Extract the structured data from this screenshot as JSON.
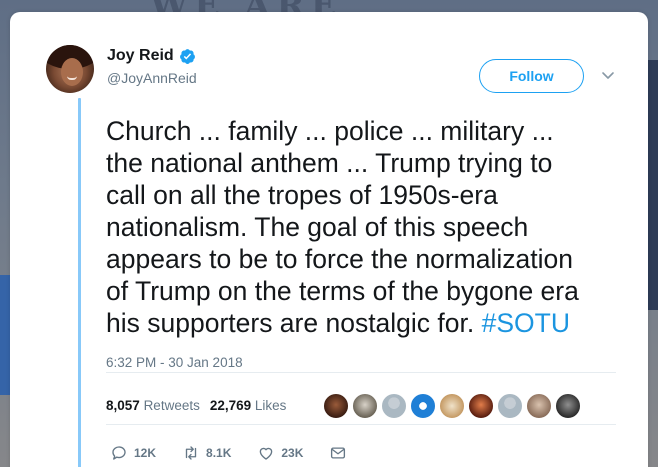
{
  "tweet": {
    "author": {
      "display_name": "Joy Reid",
      "handle": "@JoyAnnReid",
      "verified": true
    },
    "follow_label": "Follow",
    "text_lines": [
      "Church ... family ... police ... military ...",
      "the national anthem ... Trump trying to",
      "call on all the tropes of 1950s-era",
      "nationalism. The goal of this speech",
      "appears to be to force the normalization",
      "of Trump on the terms of the bygone era",
      "his supporters are nostalgic for."
    ],
    "hashtag": "#SOTU",
    "timestamp": "6:32 PM - 30 Jan 2018",
    "stats": {
      "retweets_count": "8,057",
      "retweets_label": "Retweets",
      "likes_count": "22,769",
      "likes_label": "Likes"
    },
    "actions": {
      "replies": "12K",
      "retweets": "8.1K",
      "likes": "23K"
    },
    "colors": {
      "accent": "#1da1f2",
      "rail": "#88c9f9",
      "muted": "#657786",
      "text": "#14171a"
    },
    "icons": [
      "verified-icon",
      "caret-down-icon",
      "reply-icon",
      "retweet-icon",
      "heart-icon",
      "message-icon"
    ]
  },
  "background": {
    "partial_text": "WE ARE"
  }
}
